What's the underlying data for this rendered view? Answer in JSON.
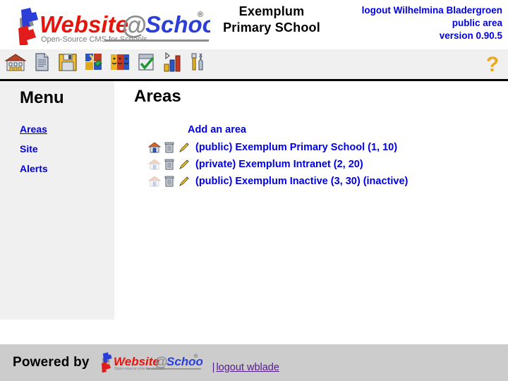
{
  "header": {
    "logo": {
      "name": "website-at-school-logo",
      "word1": "Website",
      "at": "@",
      "word2": "School",
      "registered": "®",
      "tagline": "Open-Source CMS for Schools"
    },
    "site_title_line1": "Exemplum",
    "site_title_line2": "Primary SChool",
    "logout_user": "logout Wilhelmina Bladergroen",
    "area_label": "public area",
    "version": "version 0.90.5",
    "accent_blue": "#0000e0"
  },
  "toolbar": {
    "buttons": [
      {
        "name": "school-icon",
        "title": "School"
      },
      {
        "name": "page-icon",
        "title": "Page"
      },
      {
        "name": "floppy-save-icon",
        "title": "Save"
      },
      {
        "name": "modules-puzzle-icon",
        "title": "Modules"
      },
      {
        "name": "users-faces-icon",
        "title": "Users"
      },
      {
        "name": "checklist-approve-icon",
        "title": "Approve"
      },
      {
        "name": "bar-chart-statistics-icon",
        "title": "Statistics"
      },
      {
        "name": "tools-icon",
        "title": "Tools"
      }
    ],
    "help": {
      "name": "help-question-icon",
      "glyph": "?",
      "color": "#eaa81e"
    }
  },
  "sidebar": {
    "title": "Menu",
    "items": [
      {
        "label": "Areas",
        "active": true
      },
      {
        "label": "Site",
        "active": false
      },
      {
        "label": "Alerts",
        "active": false
      }
    ]
  },
  "main": {
    "title": "Areas",
    "add_link": "Add an area",
    "rows": [
      {
        "home_active": true,
        "label": "(public) Exemplum Primary School (1, 10)"
      },
      {
        "home_active": false,
        "label": "(private) Exemplum Intranet (2, 20)"
      },
      {
        "home_active": false,
        "label": "(public) Exemplum Inactive (3, 30) (inactive)"
      }
    ]
  },
  "footer": {
    "powered_by": "Powered by",
    "logo_word1": "Website",
    "logo_at": "@",
    "logo_word2": "School",
    "logo_registered": "®",
    "logo_tagline": "Open-source cms for schools",
    "separator": "|",
    "logout_link": "logout wblade",
    "link_color": "#551a8b"
  }
}
